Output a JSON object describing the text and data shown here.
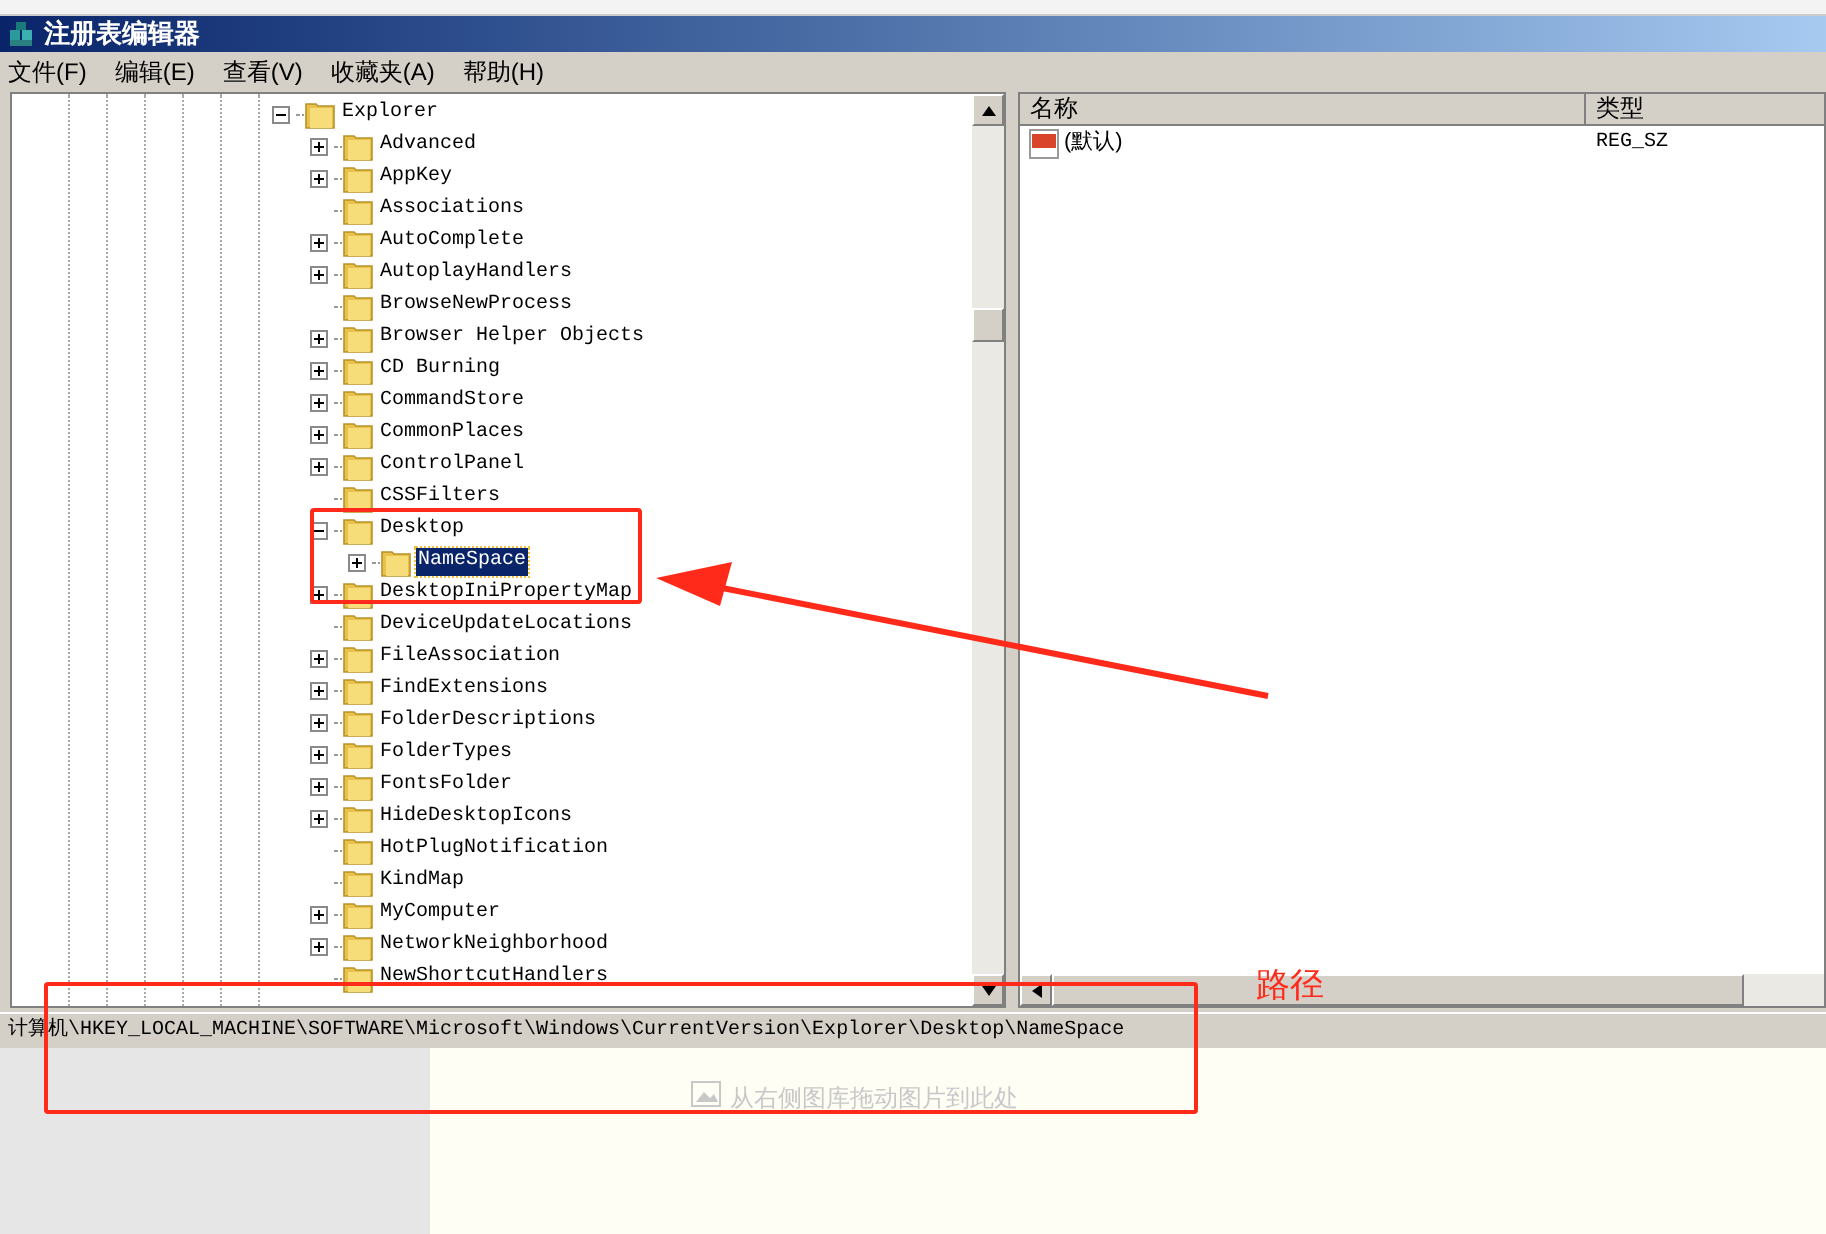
{
  "window": {
    "title": "注册表编辑器"
  },
  "menu": [
    "文件(F)",
    "编辑(E)",
    "查看(V)",
    "收藏夹(A)",
    "帮助(H)"
  ],
  "tree": [
    {
      "label": "Explorer",
      "expandable": true,
      "expanded": true,
      "selected": false,
      "children": [
        {
          "label": "Advanced",
          "expandable": true,
          "selected": false
        },
        {
          "label": "AppKey",
          "expandable": true,
          "selected": false
        },
        {
          "label": "Associations",
          "expandable": false,
          "selected": false
        },
        {
          "label": "AutoComplete",
          "expandable": true,
          "selected": false
        },
        {
          "label": "AutoplayHandlers",
          "expandable": true,
          "selected": false
        },
        {
          "label": "BrowseNewProcess",
          "expandable": false,
          "selected": false
        },
        {
          "label": "Browser Helper Objects",
          "expandable": true,
          "selected": false
        },
        {
          "label": "CD Burning",
          "expandable": true,
          "selected": false
        },
        {
          "label": "CommandStore",
          "expandable": true,
          "selected": false
        },
        {
          "label": "CommonPlaces",
          "expandable": true,
          "selected": false
        },
        {
          "label": "ControlPanel",
          "expandable": true,
          "selected": false
        },
        {
          "label": "CSSFilters",
          "expandable": false,
          "selected": false
        },
        {
          "label": "Desktop",
          "expandable": true,
          "expanded": true,
          "selected": false,
          "children": [
            {
              "label": "NameSpace",
              "expandable": true,
              "selected": true
            }
          ]
        },
        {
          "label": "DesktopIniPropertyMap",
          "expandable": true,
          "selected": false
        },
        {
          "label": "DeviceUpdateLocations",
          "expandable": false,
          "selected": false
        },
        {
          "label": "FileAssociation",
          "expandable": true,
          "selected": false
        },
        {
          "label": "FindExtensions",
          "expandable": true,
          "selected": false
        },
        {
          "label": "FolderDescriptions",
          "expandable": true,
          "selected": false
        },
        {
          "label": "FolderTypes",
          "expandable": true,
          "selected": false
        },
        {
          "label": "FontsFolder",
          "expandable": true,
          "selected": false
        },
        {
          "label": "HideDesktopIcons",
          "expandable": true,
          "selected": false
        },
        {
          "label": "HotPlugNotification",
          "expandable": false,
          "selected": false
        },
        {
          "label": "KindMap",
          "expandable": false,
          "selected": false
        },
        {
          "label": "MyComputer",
          "expandable": true,
          "selected": false
        },
        {
          "label": "NetworkNeighborhood",
          "expandable": true,
          "selected": false
        },
        {
          "label": "NewShortcutHandlers",
          "expandable": false,
          "selected": false
        }
      ]
    }
  ],
  "values": {
    "columns": [
      "名称",
      "类型"
    ],
    "rows": [
      {
        "name": "(默认)",
        "type": "REG_SZ"
      }
    ]
  },
  "status_bar": "计算机\\HKEY_LOCAL_MACHINE\\SOFTWARE\\Microsoft\\Windows\\CurrentVersion\\Explorer\\Desktop\\NameSpace",
  "drop_zone": {
    "hint": "从右侧图库拖动图片到此处"
  },
  "annotations": {
    "label": "路径"
  }
}
